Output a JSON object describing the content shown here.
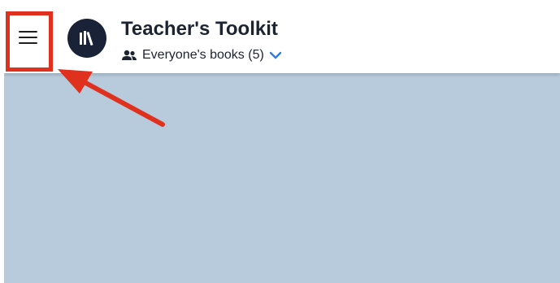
{
  "header": {
    "title": "Teacher's Toolkit",
    "subtitle": "Everyone's books (5)",
    "menu_icon": "hamburger-menu-icon",
    "logo_icon": "bookshelf-logo-icon",
    "people_icon": "people-icon",
    "chevron_icon": "chevron-down-icon"
  },
  "annotation": {
    "highlight_color": "#e0301e",
    "arrow_color": "#e0301e"
  },
  "colors": {
    "content_background": "#b8cbdc",
    "logo_background": "#1a2238",
    "chevron": "#2f7be5",
    "title_text": "#1c2331"
  }
}
